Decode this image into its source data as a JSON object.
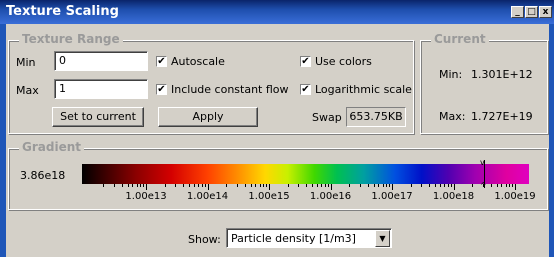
{
  "window": {
    "title": "Texture Scaling",
    "buttons": [
      "_",
      "□",
      "x"
    ]
  },
  "texture_range": {
    "title": "Texture Range",
    "min_label": "Min",
    "min_value": "0",
    "max_label": "Max",
    "max_value": "1",
    "autoscale": {
      "label": "Autoscale",
      "checked": true
    },
    "include_constant_flow": {
      "label": "Include constant flow",
      "checked": true
    },
    "use_colors": {
      "label": "Use colors",
      "checked": true
    },
    "logarithmic_scale": {
      "label": "Logarithmic scale",
      "checked": true
    },
    "set_to_current_label": "Set to current",
    "apply_label": "Apply",
    "swap_label": "Swap",
    "swap_value": "653.75KB"
  },
  "current": {
    "title": "Current",
    "min_label": "Min:",
    "min_value": "1.301E+12",
    "max_label": "Max:",
    "max_value": "1.727E+19"
  },
  "gradient": {
    "title": "Gradient",
    "value_readout": "3.86e18",
    "tick_labels": [
      "1.00e13",
      "1.00e14",
      "1.00e15",
      "1.00e16",
      "1.00e17",
      "1.00e18",
      "1.00e19"
    ]
  },
  "show": {
    "label": "Show:",
    "selected": "Particle density [1/m3]"
  },
  "colors": {
    "titlebar": "#0a246a",
    "panel": "#d4d0c8"
  }
}
